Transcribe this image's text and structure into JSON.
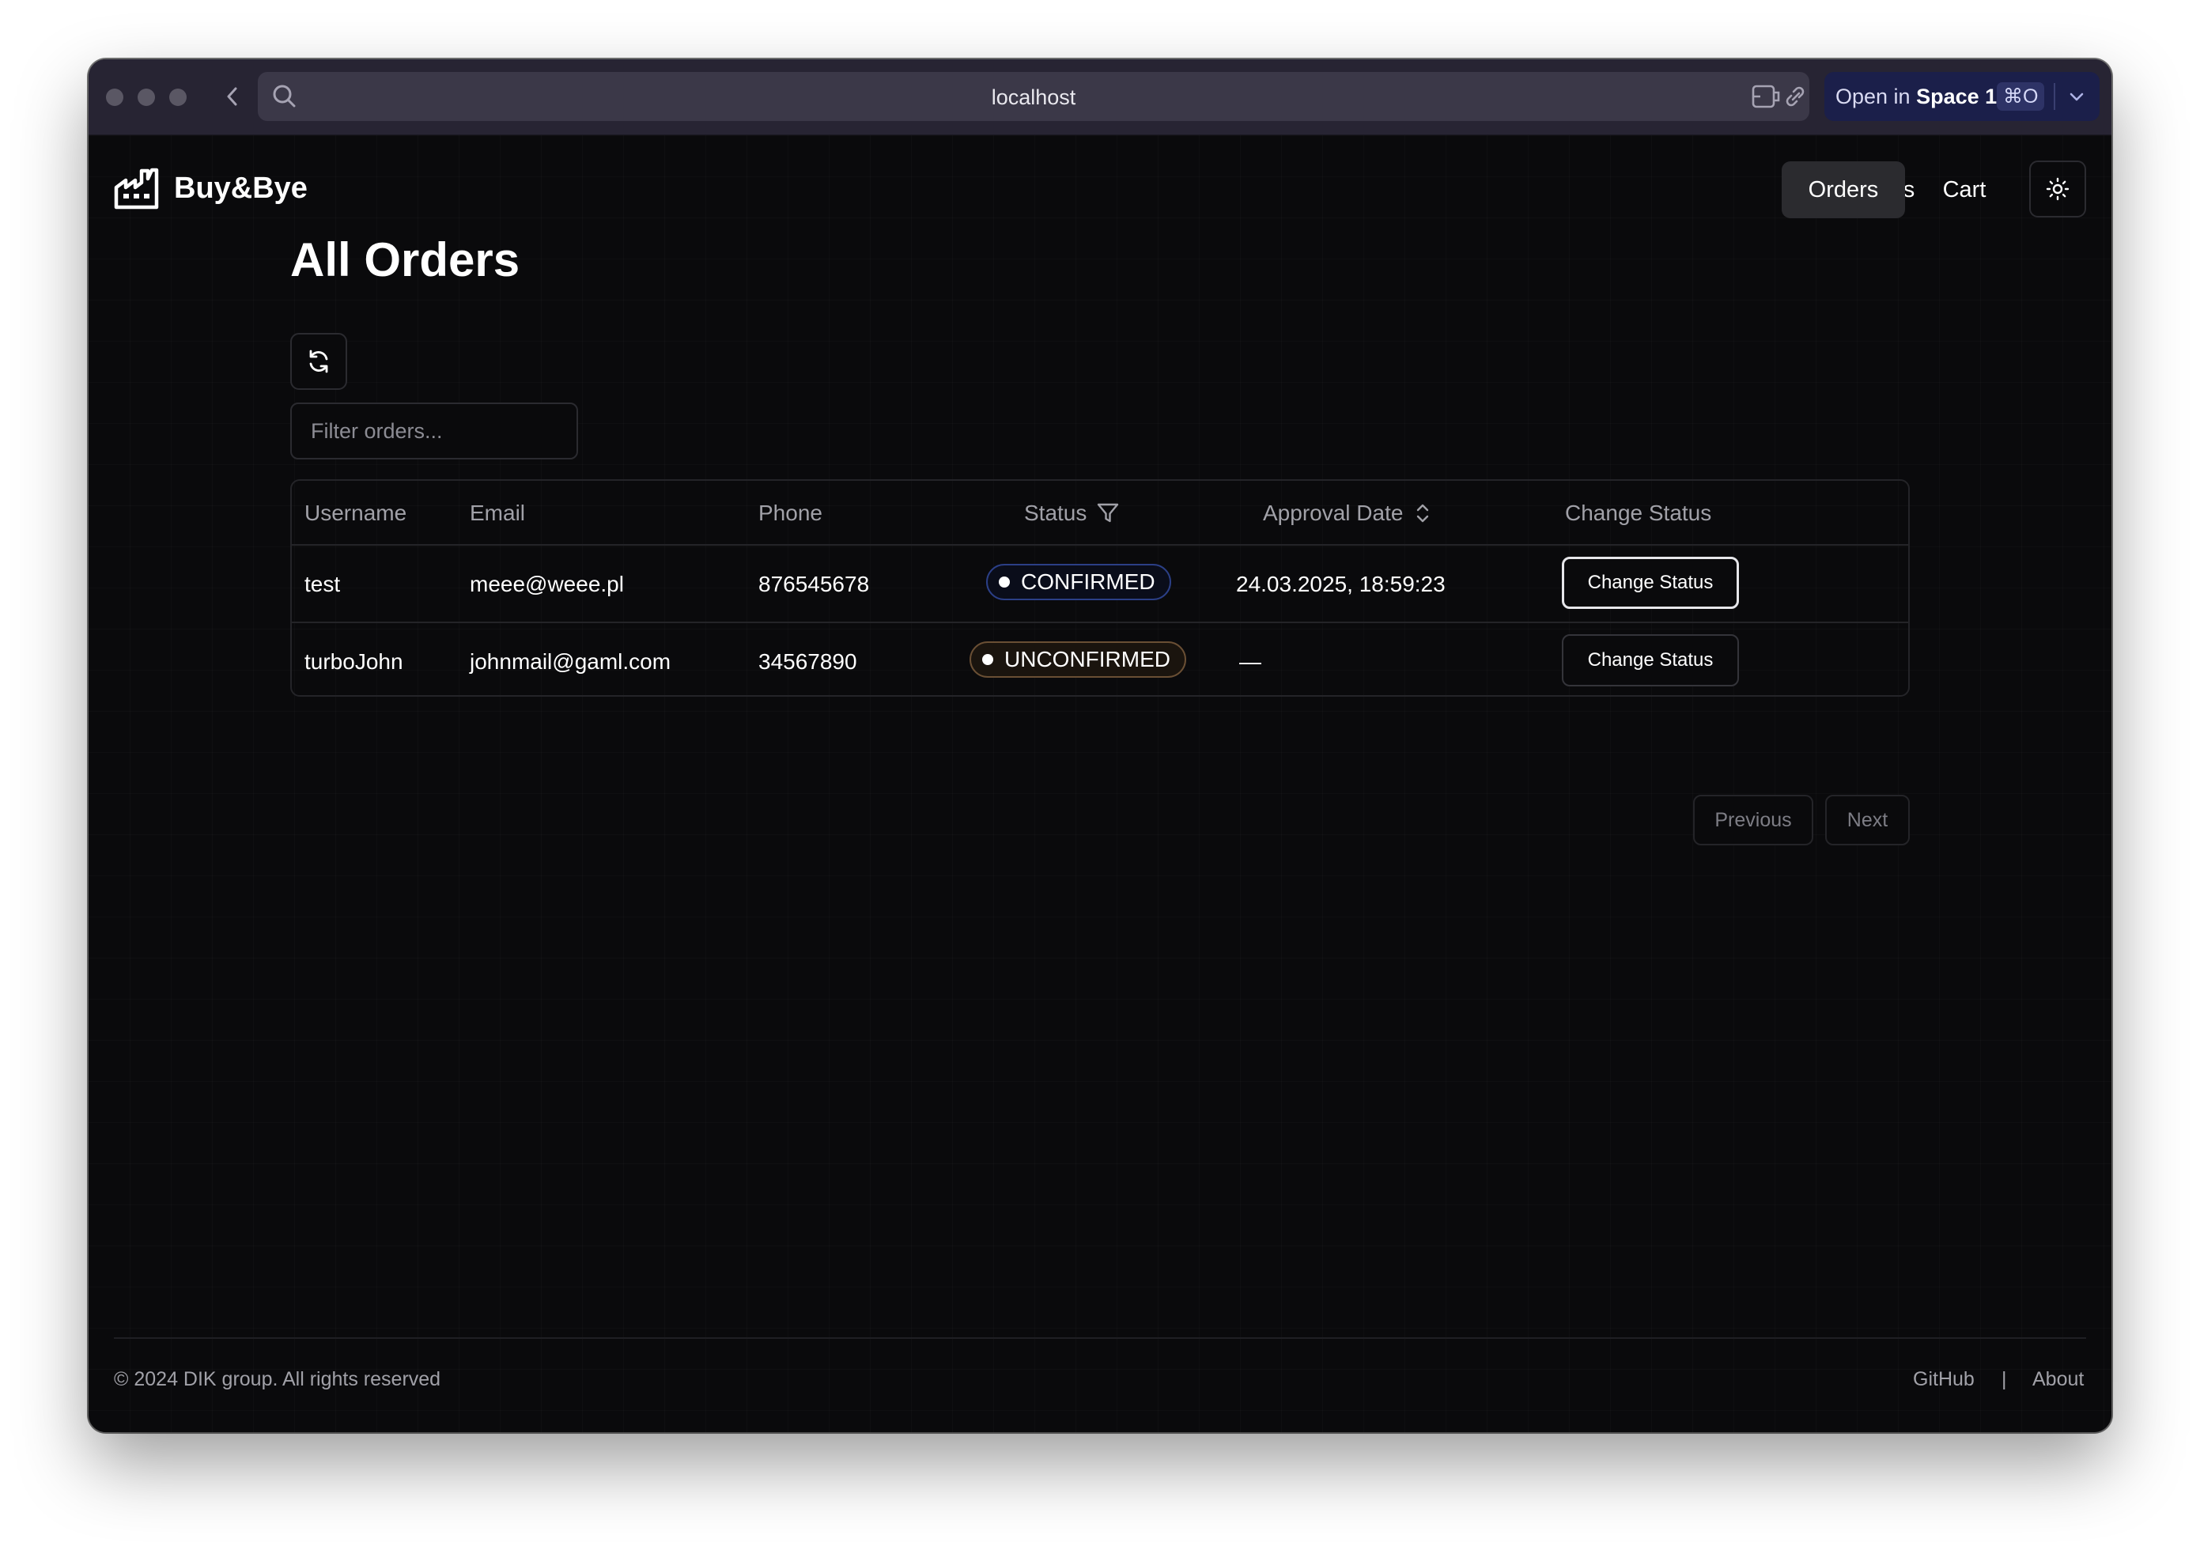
{
  "browser": {
    "url": "localhost",
    "open_in_prefix": "Open in",
    "space_name": "Space 1",
    "shortcut": "⌘O"
  },
  "header": {
    "brand": "Buy&Bye",
    "nav": [
      {
        "label": "Products",
        "active": false
      },
      {
        "label": "Orders",
        "active": true
      },
      {
        "label": "Cart",
        "active": false
      }
    ]
  },
  "page": {
    "title": "All Orders",
    "filter_placeholder": "Filter orders..."
  },
  "table": {
    "columns": [
      "Username",
      "Email",
      "Phone",
      "Status",
      "Approval Date",
      "Change Status"
    ],
    "rows": [
      {
        "username": "test",
        "email": "meee@weee.pl",
        "phone": "876545678",
        "status": "CONFIRMED",
        "approval_date": "24.03.2025, 18:59:23",
        "action": "Change Status"
      },
      {
        "username": "turboJohn",
        "email": "johnmail@gaml.com",
        "phone": "34567890",
        "status": "UNCONFIRMED",
        "approval_date": "—",
        "action": "Change Status"
      }
    ]
  },
  "pagination": {
    "previous": "Previous",
    "next": "Next"
  },
  "footer": {
    "copyright": "© 2024 DIK group. All rights reserved",
    "links": [
      "GitHub",
      "About"
    ],
    "separator": "|"
  },
  "colors": {
    "background": "#0a0a0c",
    "chrome": "#272433",
    "confirmed_border": "#2b3f86",
    "unconfirmed_border": "#6a4f34",
    "muted_text": "#a1a1a8"
  }
}
